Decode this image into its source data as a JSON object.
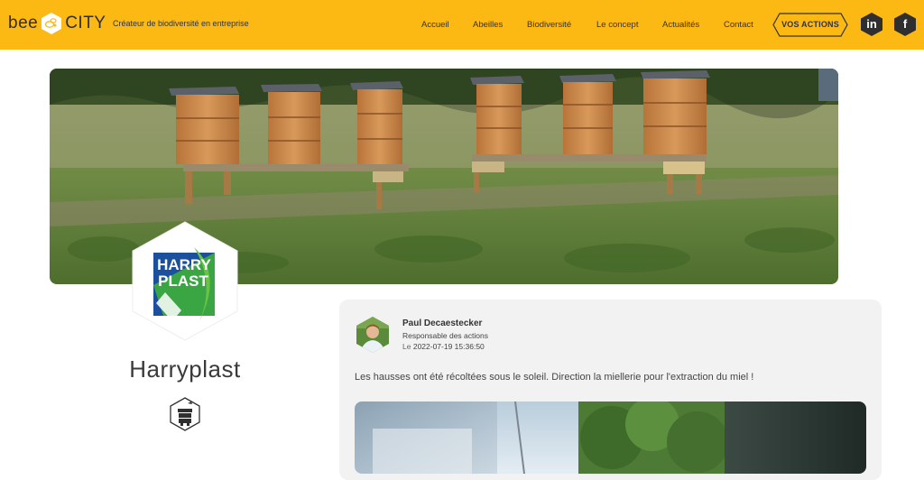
{
  "header": {
    "logo_left": "bee",
    "logo_right": "CITY",
    "tagline": "Créateur de biodiversité en entreprise",
    "nav": [
      "Accueil",
      "Abeilles",
      "Biodiversité",
      "Le concept",
      "Actualités",
      "Contact"
    ],
    "cta_label": "VOS ACTIONS",
    "social": {
      "linkedin": "in",
      "facebook": "f"
    }
  },
  "company": {
    "logo_line1": "HARRY",
    "logo_line2": "PLAST",
    "name": "Harryplast"
  },
  "post": {
    "author": "Paul Decaestecker",
    "role": "Responsable des actions",
    "date_prefix": "Le",
    "date": "2022-07-19 15:36:50",
    "text": "Les hausses ont été récoltées sous le soleil. Direction la miellerie pour l'extraction du miel !"
  },
  "colors": {
    "brand_yellow": "#fcb813",
    "dark": "#2f2f2f",
    "card_bg": "#f2f2f2",
    "logo_blue": "#1c4f9c",
    "logo_green": "#3eae3a"
  },
  "icons": [
    "bee-hex-icon",
    "linkedin-icon",
    "facebook-icon",
    "beehive-icon"
  ]
}
